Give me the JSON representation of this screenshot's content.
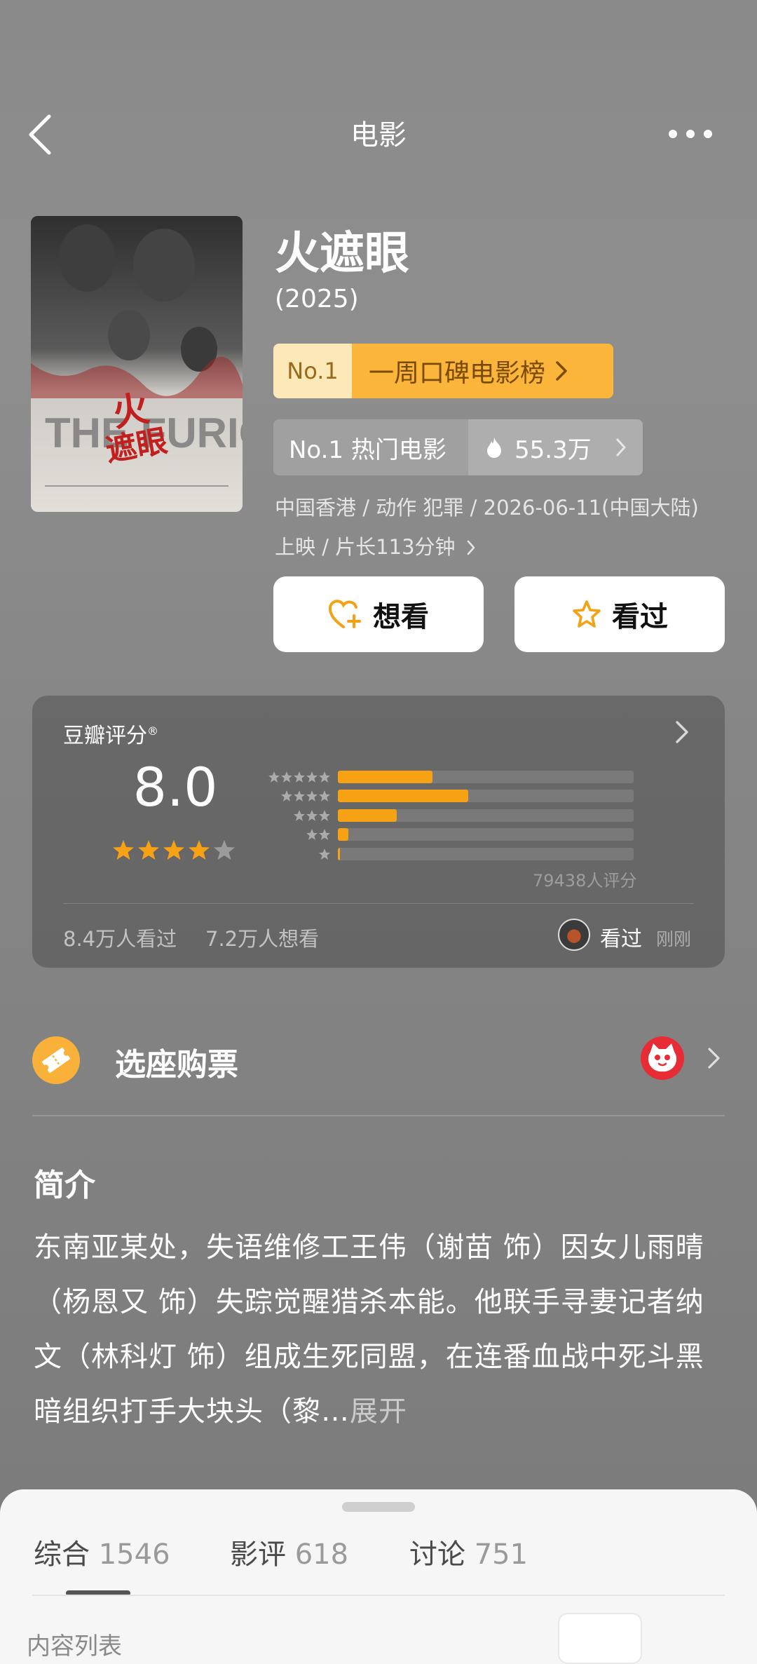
{
  "header": {
    "title": "电影"
  },
  "movie": {
    "title": "火遮眼",
    "year": "(2025)",
    "rank": {
      "no": "No.1",
      "label": "一周口碑电影榜"
    },
    "hot": {
      "label": "No.1 热门电影",
      "count": "55.3万"
    },
    "meta_line1": "中国香港 / 动作 犯罪 / 2026-06-11(中国大陆)",
    "meta_line2": "上映 / 片长113分钟"
  },
  "actions": {
    "want": "想看",
    "seen": "看过"
  },
  "rating": {
    "label": "豆瓣评分",
    "score": "8.0",
    "stars_filled": 4,
    "distribution": [
      0.32,
      0.44,
      0.2,
      0.035,
      0.008
    ],
    "count": "79438人评分",
    "seen_stat": "8.4万人看过",
    "want_stat": "7.2万人想看",
    "friend_tag": "看过",
    "friend_time": "刚刚"
  },
  "ticket": {
    "label": "选座购票"
  },
  "intro": {
    "title": "简介",
    "body": "东南亚某处，失语维修工王伟（谢苗 饰）因女儿雨晴（杨恩又 饰）失踪觉醒猎杀本能。他联手寻妻记者纳文（林科灯 饰）组成生死同盟，在连番血战中死斗黑暗组织打手大块头（黎…",
    "more": "展开"
  },
  "tabs": [
    {
      "label": "综合",
      "count": "1546"
    },
    {
      "label": "影评",
      "count": "618"
    },
    {
      "label": "讨论",
      "count": "751"
    }
  ],
  "list_label": "内容列表",
  "colors": {
    "accent": "#f7a114",
    "rank_bg": "#fbb53a",
    "maoyan": "#e72c35"
  },
  "icons": [
    "back-icon",
    "more-icon",
    "heart-plus-icon",
    "star-outline-icon",
    "flame-icon",
    "ticket-icon",
    "maoyan-cat-icon",
    "chevron-right-icon"
  ]
}
